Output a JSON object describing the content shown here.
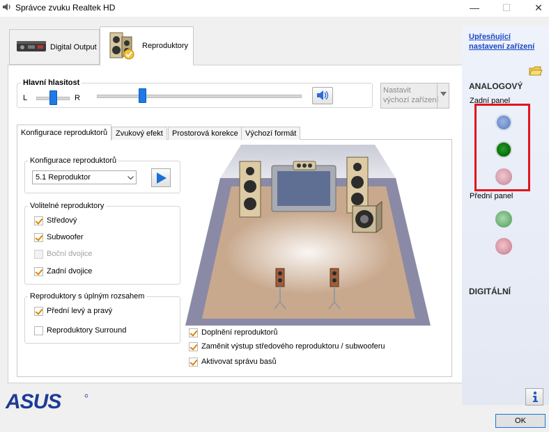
{
  "window": {
    "title": "Správce zvuku Realtek HD",
    "minimize": "—",
    "maximize": "☐",
    "close": "✕"
  },
  "main_tabs": [
    {
      "label": "Digital Output",
      "icon": "digital-device-icon"
    },
    {
      "label": "Reproduktory",
      "icon": "speakers-icon"
    }
  ],
  "volume": {
    "title": "Hlavní hlasitost",
    "left": "L",
    "right": "R",
    "balance": 0.5,
    "level": 0.21
  },
  "default_device": {
    "line1": "Nastavit",
    "line2": "výchozí zařízení"
  },
  "sub_tabs": [
    "Konfigurace reproduktorů",
    "Zvukový efekt",
    "Prostorová korekce",
    "Výchozí formát"
  ],
  "config": {
    "group_title": "Konfigurace reproduktorů",
    "selected": "5.1 Reproduktor"
  },
  "optional": {
    "title": "Volitelné reproduktory",
    "items": [
      {
        "label": "Středový",
        "checked": true,
        "disabled": false
      },
      {
        "label": "Subwoofer",
        "checked": true,
        "disabled": false
      },
      {
        "label": "Boční dvojice",
        "checked": false,
        "disabled": true
      },
      {
        "label": "Zadní dvojice",
        "checked": true,
        "disabled": false
      }
    ]
  },
  "fullrange": {
    "title": "Reproduktory s úplným rozsahem",
    "items": [
      {
        "label": "Přední levý a pravý",
        "checked": true
      },
      {
        "label": "Reproduktory Surround",
        "checked": false
      }
    ]
  },
  "bottom_options": [
    {
      "label": "Doplnění reproduktorů",
      "checked": true
    },
    {
      "label": "Zaměnit výstup středového reproduktoru / subwooferu",
      "checked": true
    },
    {
      "label": "Aktivovat správu basů",
      "checked": true
    }
  ],
  "right_panel": {
    "link_line1": "Upřesňující",
    "link_line2": "nastavení zařízení",
    "analog": "ANALOGOVÝ",
    "rear": "Zadní panel",
    "front": "Přední panel",
    "digital": "DIGITÁLNÍ",
    "jack_colors": {
      "blue": "#6f8fc8",
      "green": "#0d7a10",
      "pink": "#d9a3b0",
      "front_green": "#76b77c",
      "front_pink": "#d99aa6"
    }
  },
  "ok_label": "OK",
  "brand": "ASUS"
}
